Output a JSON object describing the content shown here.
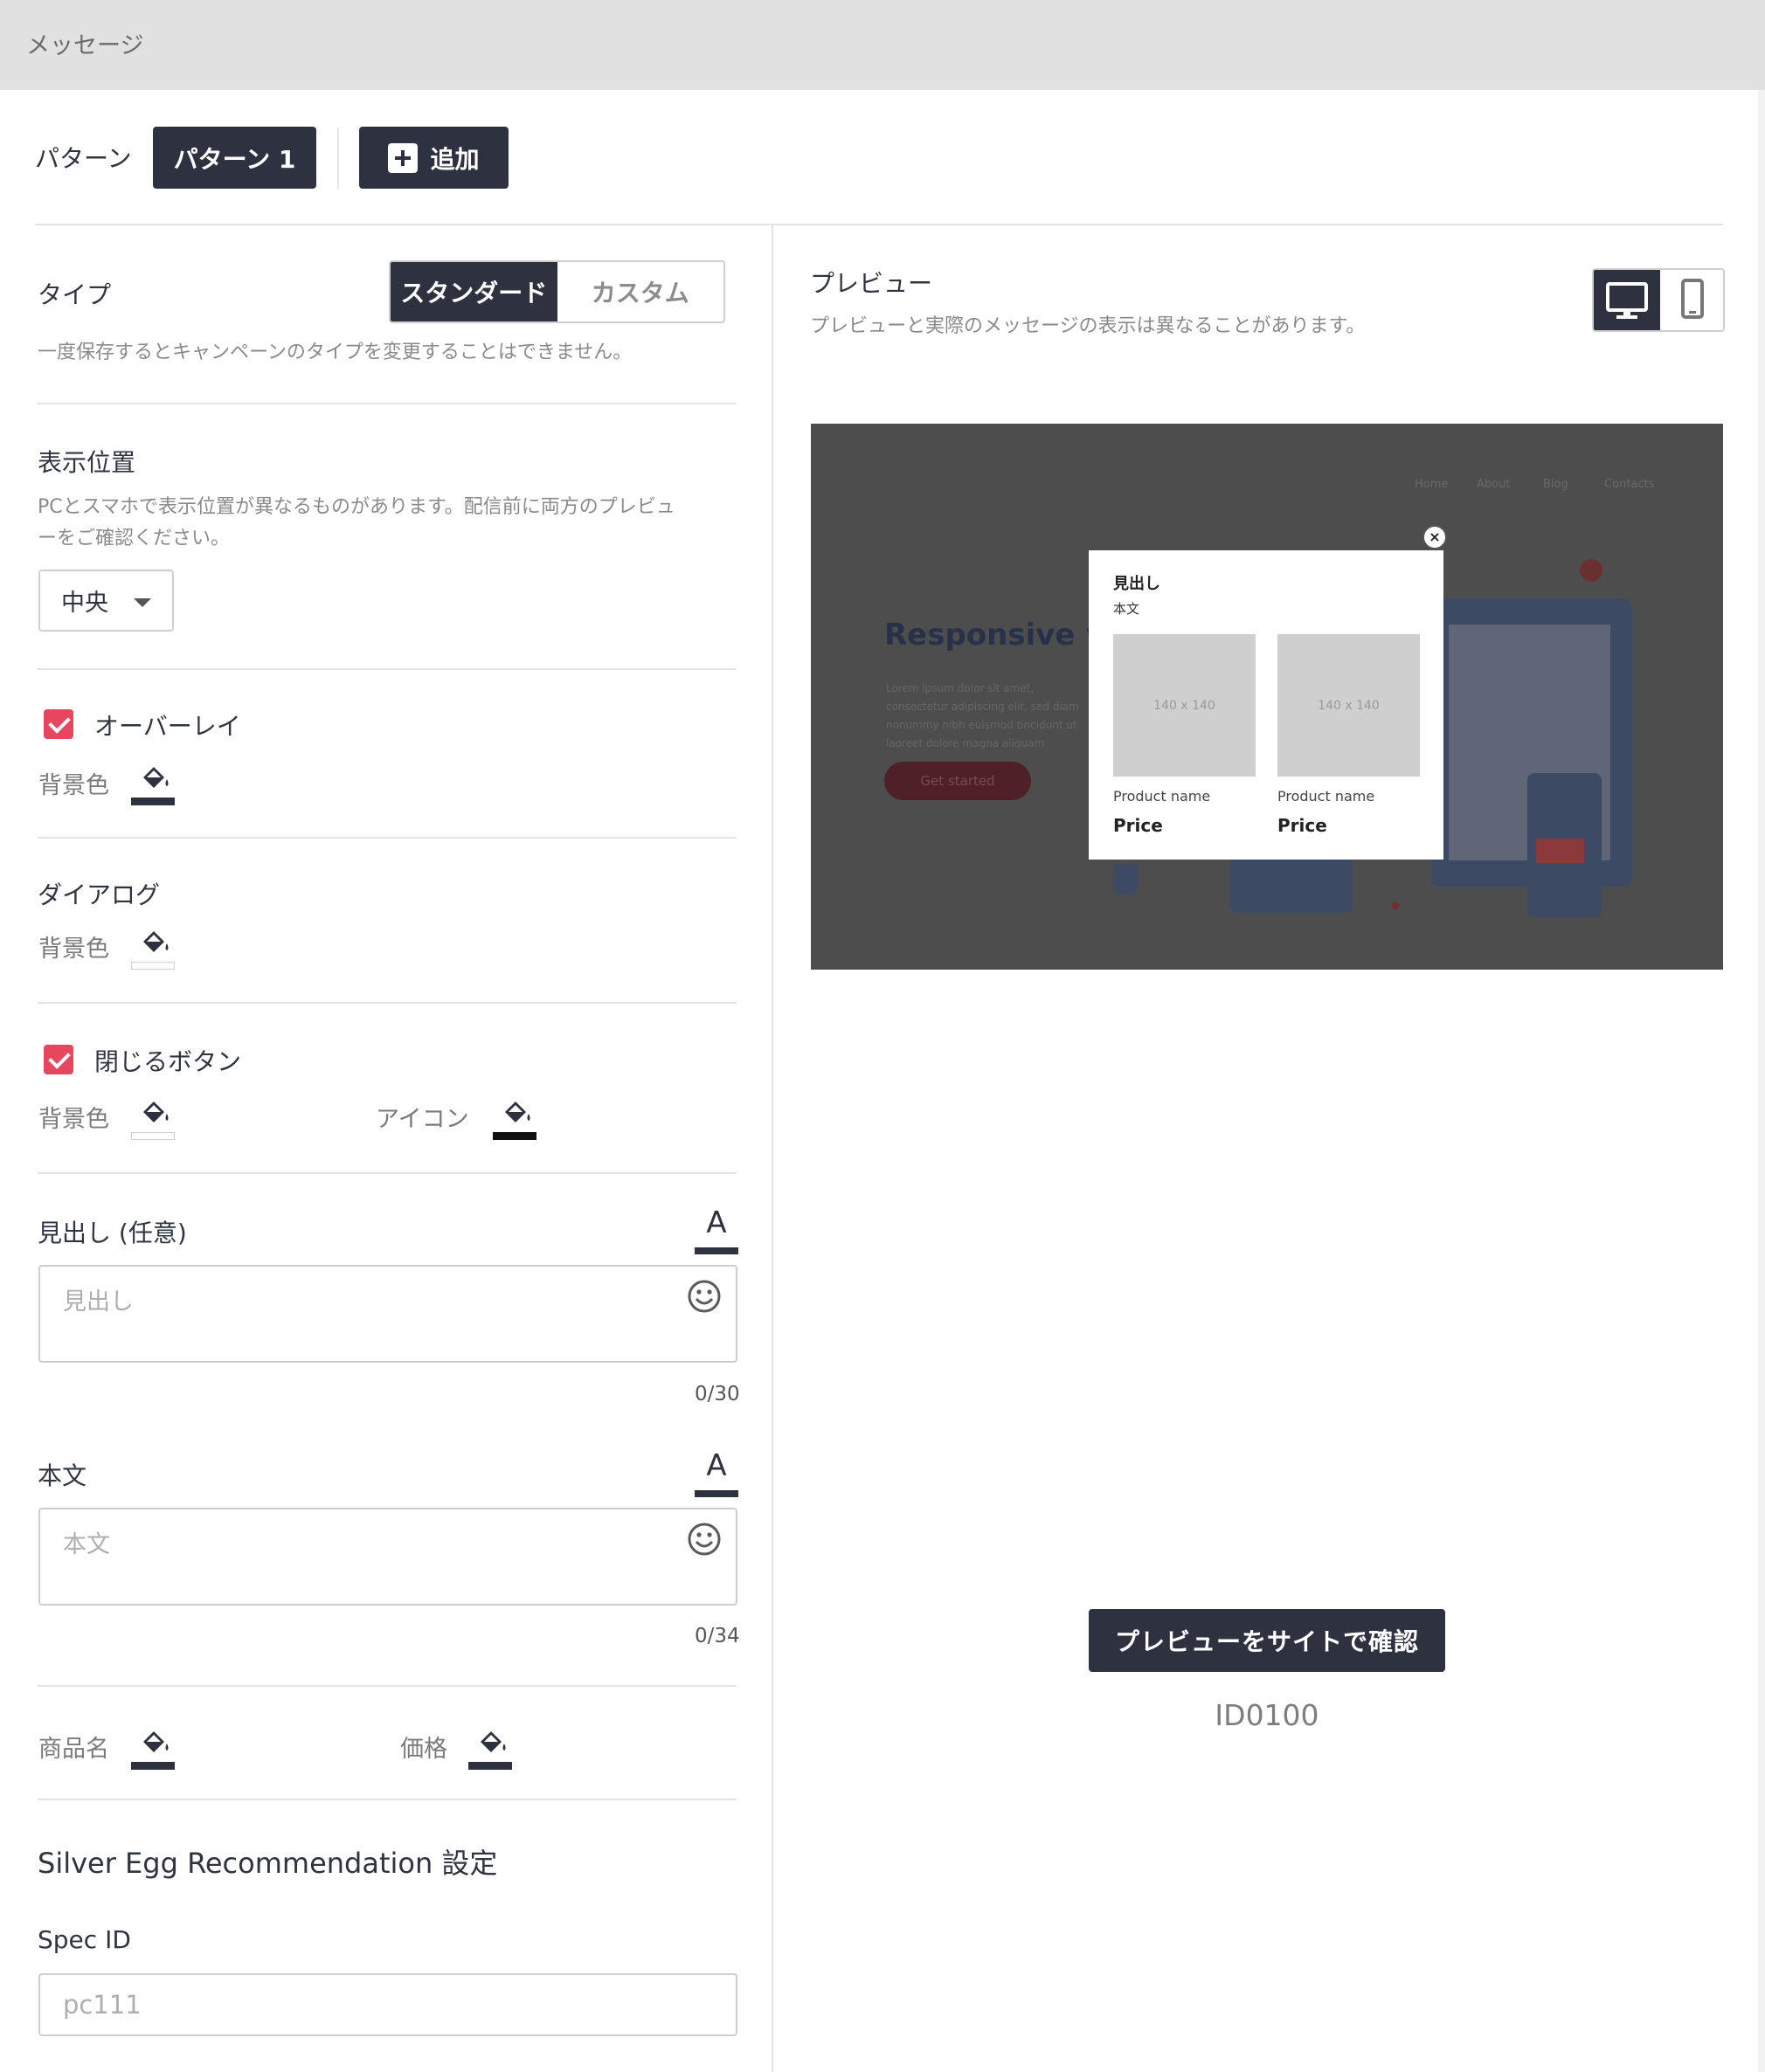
{
  "header": {
    "title": "メッセージ"
  },
  "pattern": {
    "label": "パターン",
    "active": "パターン 1",
    "add_label": "追加"
  },
  "type": {
    "label": "タイプ",
    "options": [
      "スタンダード",
      "カスタム"
    ],
    "selected": "スタンダード",
    "help": "一度保存するとキャンペーンのタイプを変更することはできません。"
  },
  "position": {
    "label": "表示位置",
    "help_line1": "PCとスマホで表示位置が異なるものがあります。配信前に両方のプレビュ",
    "help_line2": "ーをご確認ください。",
    "value": "中央"
  },
  "overlay": {
    "label": "オーバーレイ",
    "checked": true,
    "bg_label": "背景色"
  },
  "dialog": {
    "label": "ダイアログ",
    "bg_label": "背景色"
  },
  "close_button": {
    "label": "閉じるボタン",
    "checked": true,
    "bg_label": "背景色",
    "icon_label": "アイコン"
  },
  "heading": {
    "label": "見出し (任意)",
    "placeholder": "見出し",
    "counter": "0/30"
  },
  "body": {
    "label": "本文",
    "placeholder": "本文",
    "counter": "0/34"
  },
  "product": {
    "name_label": "商品名",
    "price_label": "価格"
  },
  "recommendation": {
    "title": "Silver Egg Recommendation 設定",
    "spec_label": "Spec ID",
    "spec_value": "pc111"
  },
  "preview": {
    "label": "プレビュー",
    "note": "プレビューと実際のメッセージの表示は異なることがあります。",
    "device_selected": "desktop",
    "site": {
      "nav": [
        "Home",
        "About",
        "Blog",
        "Contacts"
      ],
      "hero": "Responsive wel",
      "lorem": "Lorem ipsum dolor sit amet, consectetur adipiscing elit, sed diam nonummy nibh euismod tincidunt ut laoreet dolore magna aliquam",
      "cta": "Get started"
    },
    "dialog": {
      "heading": "見出し",
      "body": "本文",
      "products": [
        {
          "image_label": "140 x 140",
          "name": "Product name",
          "price": "Price"
        },
        {
          "image_label": "140 x 140",
          "name": "Product name",
          "price": "Price"
        }
      ]
    },
    "site_button": "プレビューをサイトで確認",
    "id": "ID0100"
  },
  "colors": {
    "primary": "#2e3240",
    "checkbox": "#e8455e",
    "overlay": "#4d4d4d"
  }
}
